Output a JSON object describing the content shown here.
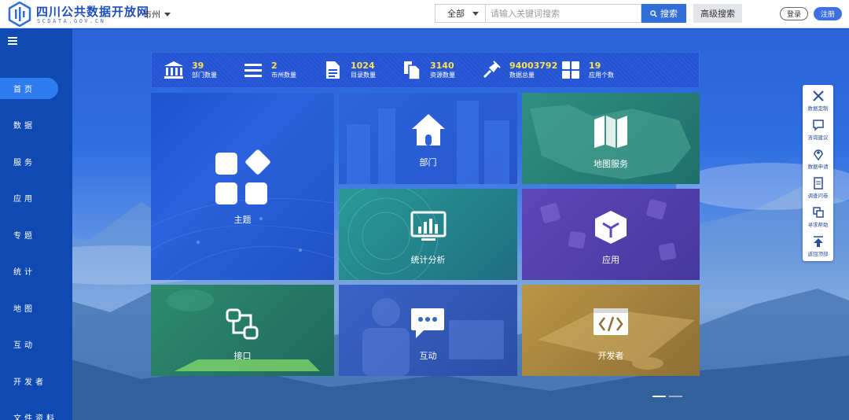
{
  "header": {
    "logo_title": "四川公共数据开放网",
    "logo_sub": "SCDATA.GOV.CN",
    "city_label": "市州",
    "search": {
      "category": "全部",
      "placeholder": "请输入关键词搜索",
      "button_label": "搜索",
      "advanced_label": "高级搜索"
    },
    "login_label": "登录",
    "register_label": "注册"
  },
  "sidebar": {
    "items": [
      {
        "label": "首页",
        "active": true
      },
      {
        "label": "数据",
        "active": false
      },
      {
        "label": "服务",
        "active": false
      },
      {
        "label": "应用",
        "active": false
      },
      {
        "label": "专题",
        "active": false
      },
      {
        "label": "统计",
        "active": false
      },
      {
        "label": "地图",
        "active": false
      },
      {
        "label": "互动",
        "active": false
      },
      {
        "label": "开发者",
        "active": false
      },
      {
        "label": "文件资料",
        "active": false
      }
    ]
  },
  "stats": [
    {
      "value": "39",
      "label": "部门数量",
      "icon": "building-icon"
    },
    {
      "value": "2",
      "label": "市州数量",
      "icon": "list-icon"
    },
    {
      "value": "1024",
      "label": "目录数量",
      "icon": "document-icon"
    },
    {
      "value": "3140",
      "label": "资源数量",
      "icon": "files-icon"
    },
    {
      "value": "94003792",
      "label": "数据总量",
      "icon": "plug-icon"
    },
    {
      "value": "19",
      "label": "应用个数",
      "icon": "grid-icon"
    }
  ],
  "tiles": {
    "theme": "主题",
    "dept": "部门",
    "map": "地图服务",
    "stat": "统计分析",
    "app": "应用",
    "api": "接口",
    "inter": "互动",
    "dev": "开发者"
  },
  "float_bar": [
    {
      "label": "数据定制",
      "icon": "tools-icon"
    },
    {
      "label": "咨询建议",
      "icon": "chat-icon"
    },
    {
      "label": "数据申请",
      "icon": "pin-icon"
    },
    {
      "label": "调查问卷",
      "icon": "form-icon"
    },
    {
      "label": "寻求帮助",
      "icon": "help-icon"
    },
    {
      "label": "返回顶部",
      "icon": "arrow-up-icon"
    }
  ],
  "colors": {
    "brand": "#1e4fc0",
    "sidebar": "#0f4ab2",
    "stat_value": "#ffe34a",
    "search_button": "#2f6fd6"
  }
}
